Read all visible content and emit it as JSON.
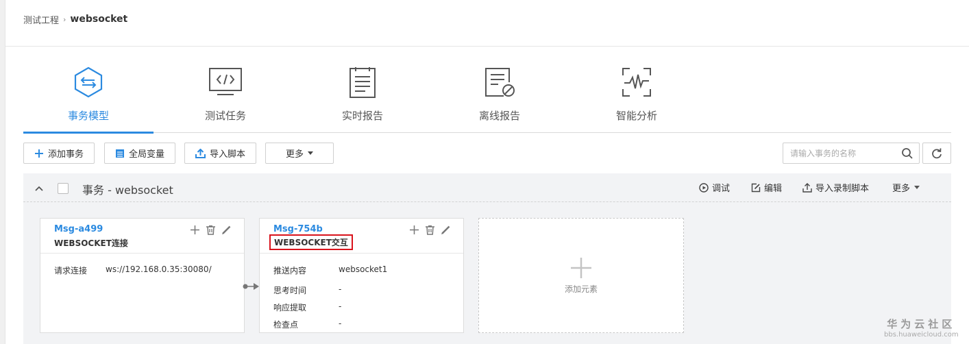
{
  "breadcrumb": {
    "project": "测试工程",
    "current": "websocket"
  },
  "tabs": [
    {
      "label": "事务模型",
      "icon": "transaction-model-icon",
      "active": true
    },
    {
      "label": "测试任务",
      "icon": "code-monitor-icon",
      "active": false
    },
    {
      "label": "实时报告",
      "icon": "clipboard-report-icon",
      "active": false
    },
    {
      "label": "离线报告",
      "icon": "offline-report-icon",
      "active": false
    },
    {
      "label": "智能分析",
      "icon": "waveform-analysis-icon",
      "active": false
    }
  ],
  "toolbar": {
    "add_transaction": "添加事务",
    "global_vars": "全局变量",
    "import_script": "导入脚本",
    "more": "更多"
  },
  "search": {
    "placeholder": "请输入事务的名称"
  },
  "panel": {
    "title": "事务 - websocket",
    "actions": {
      "debug": "调试",
      "edit": "编辑",
      "import_record": "导入录制脚本",
      "more": "更多"
    }
  },
  "cards": [
    {
      "id": "Msg-a499",
      "name": "WEBSOCKET连接",
      "fields": [
        {
          "key": "请求连接",
          "value": "ws://192.168.0.35:30080/"
        }
      ]
    },
    {
      "id": "Msg-754b",
      "name": "WEBSOCKET交互",
      "highlighted": true,
      "fields": [
        {
          "key": "推送内容",
          "value": "websocket1"
        },
        {
          "key": "思考时间",
          "value": "-"
        },
        {
          "key": "响应提取",
          "value": "-"
        },
        {
          "key": "检查点",
          "value": "-"
        }
      ]
    }
  ],
  "add_element": {
    "label": "添加元素"
  },
  "watermark": {
    "title": "华为云社区",
    "url": "bbs.huaweicloud.com"
  },
  "colors": {
    "accent": "#2b8ae0",
    "highlight_border": "#d9121b",
    "panel_bg": "#f2f3f5"
  }
}
